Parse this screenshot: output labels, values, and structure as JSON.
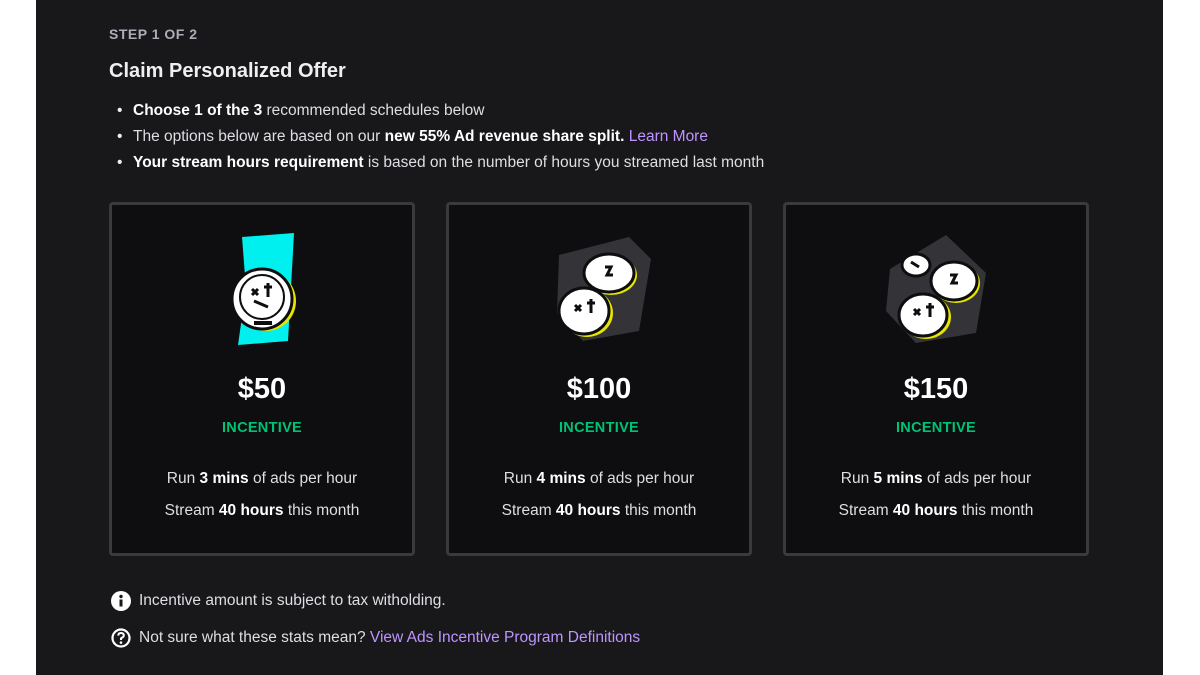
{
  "header": {
    "step": "STEP 1 OF 2",
    "title": "Claim Personalized Offer"
  },
  "bullets": [
    {
      "bold": "Choose 1 of the 3",
      "text": " recommended schedules below"
    },
    {
      "pre": "The options below are based on our ",
      "bold": "new 55% Ad revenue share split.",
      "link": "Learn More"
    },
    {
      "bold": "Your stream hours requirement",
      "text": " is based on the number of hours you streamed last month"
    }
  ],
  "offers": [
    {
      "amount": "$50",
      "label": "INCENTIVE",
      "ads_pre": "Run ",
      "ads_bold": "3 mins",
      "ads_post": " of ads per hour",
      "hours_pre": "Stream ",
      "hours_bold": "40 hours",
      "hours_post": " this month",
      "art": "single-coin-illustration"
    },
    {
      "amount": "$100",
      "label": "INCENTIVE",
      "ads_pre": "Run ",
      "ads_bold": "4 mins",
      "ads_post": " of ads per hour",
      "hours_pre": "Stream ",
      "hours_bold": "40 hours",
      "hours_post": " this month",
      "art": "two-coins-illustration"
    },
    {
      "amount": "$150",
      "label": "INCENTIVE",
      "ads_pre": "Run ",
      "ads_bold": "5 mins",
      "ads_post": " of ads per hour",
      "hours_pre": "Stream ",
      "hours_bold": "40 hours",
      "hours_post": " this month",
      "art": "three-coins-illustration"
    }
  ],
  "notes": {
    "tax": "Incentive amount is subject to tax witholding.",
    "help_pre": "Not sure what these stats mean? ",
    "help_link": "View Ads Incentive Program Definitions"
  },
  "colors": {
    "background": "#18181b",
    "card": "#0e0e10",
    "accent_link": "#bf94ff",
    "incentive_green": "#00c274",
    "coin_highlight": "#00f0f0",
    "coin_ring": "#e6e600"
  }
}
